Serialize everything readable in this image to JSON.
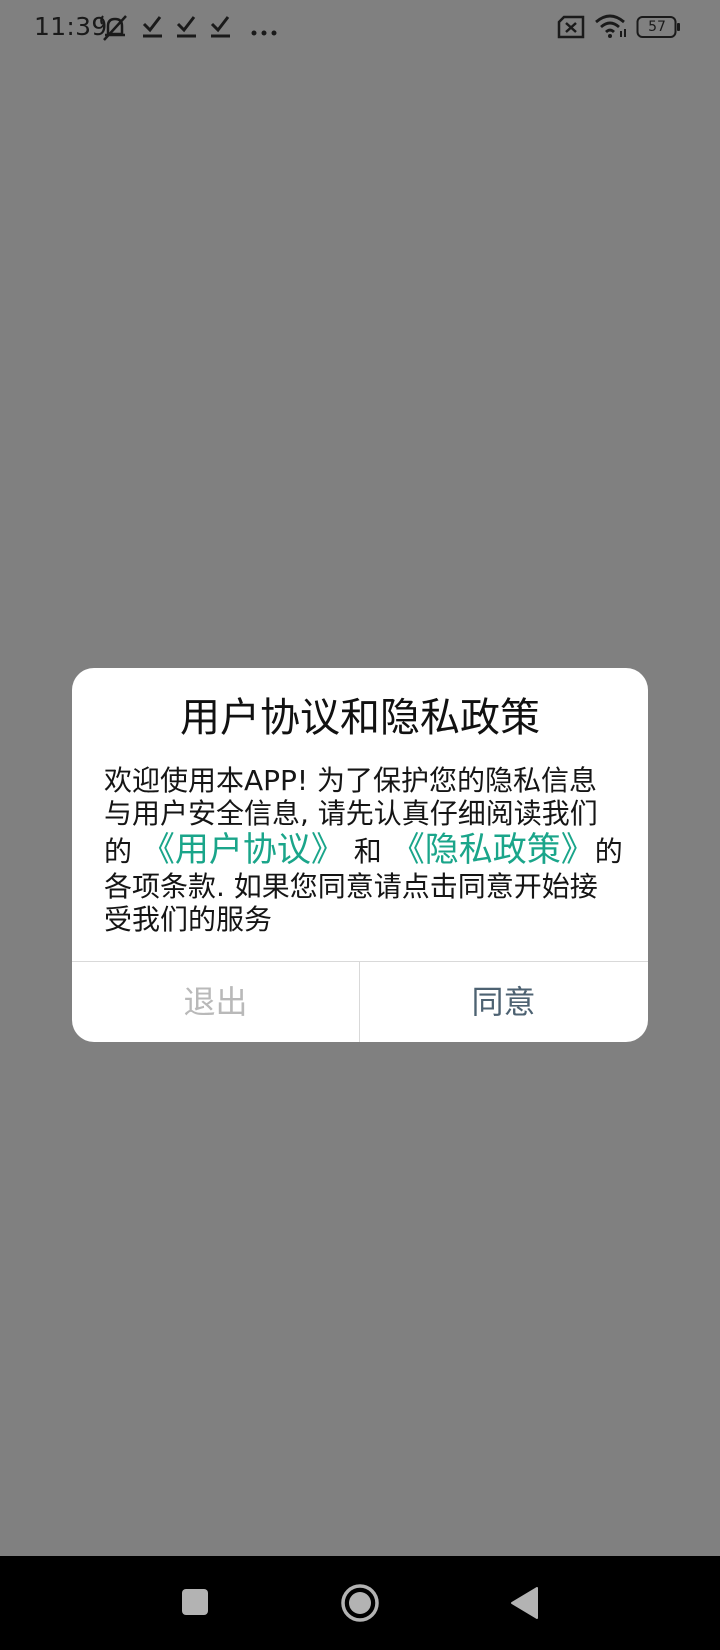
{
  "status_bar": {
    "time": "11:39",
    "battery_level": "57",
    "icons": [
      "notifications-muted-icon",
      "check-icon",
      "check-icon",
      "check-icon",
      "more-dots-icon",
      "no-sim-icon",
      "wifi-icon",
      "battery-icon"
    ]
  },
  "dialog": {
    "title": "用户协议和隐私政策",
    "body_part1": "欢迎使用本APP! 为了保护您的隐私信息与用户安全信息, 请先认真仔细阅读我们的 ",
    "user_agreement_link": "《用户协议》",
    "conjunction": " 和 ",
    "privacy_policy_link": "《隐私政策》",
    "body_part2": "的各项条款. 如果您同意请点击同意开始接受我们的服务",
    "exit_label": "退出",
    "agree_label": "同意",
    "link_color": "#1aa58a",
    "agree_color": "#4d6272",
    "exit_color": "#b9b9b9"
  },
  "nav_bar": {
    "buttons": [
      "recent-apps-icon",
      "home-icon",
      "back-icon"
    ]
  }
}
